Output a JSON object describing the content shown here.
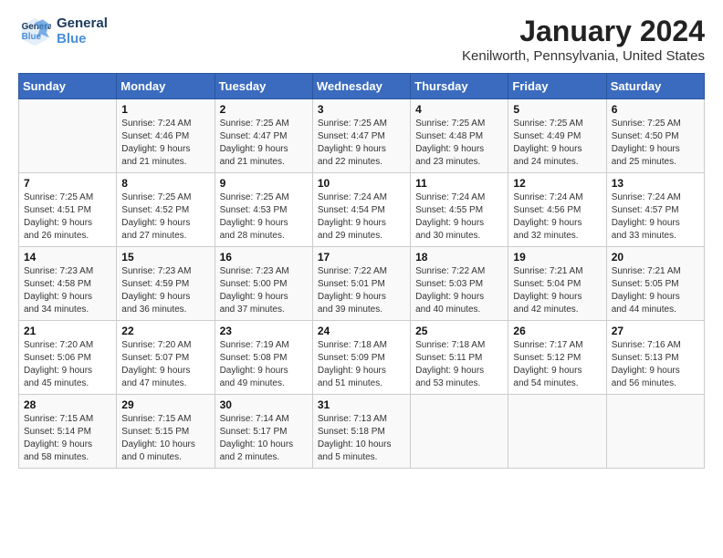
{
  "header": {
    "logo_line1": "General",
    "logo_line2": "Blue",
    "title": "January 2024",
    "subtitle": "Kenilworth, Pennsylvania, United States"
  },
  "days_of_week": [
    "Sunday",
    "Monday",
    "Tuesday",
    "Wednesday",
    "Thursday",
    "Friday",
    "Saturday"
  ],
  "weeks": [
    [
      {
        "day": "",
        "info": ""
      },
      {
        "day": "1",
        "info": "Sunrise: 7:24 AM\nSunset: 4:46 PM\nDaylight: 9 hours\nand 21 minutes."
      },
      {
        "day": "2",
        "info": "Sunrise: 7:25 AM\nSunset: 4:47 PM\nDaylight: 9 hours\nand 21 minutes."
      },
      {
        "day": "3",
        "info": "Sunrise: 7:25 AM\nSunset: 4:47 PM\nDaylight: 9 hours\nand 22 minutes."
      },
      {
        "day": "4",
        "info": "Sunrise: 7:25 AM\nSunset: 4:48 PM\nDaylight: 9 hours\nand 23 minutes."
      },
      {
        "day": "5",
        "info": "Sunrise: 7:25 AM\nSunset: 4:49 PM\nDaylight: 9 hours\nand 24 minutes."
      },
      {
        "day": "6",
        "info": "Sunrise: 7:25 AM\nSunset: 4:50 PM\nDaylight: 9 hours\nand 25 minutes."
      }
    ],
    [
      {
        "day": "7",
        "info": "Sunrise: 7:25 AM\nSunset: 4:51 PM\nDaylight: 9 hours\nand 26 minutes."
      },
      {
        "day": "8",
        "info": "Sunrise: 7:25 AM\nSunset: 4:52 PM\nDaylight: 9 hours\nand 27 minutes."
      },
      {
        "day": "9",
        "info": "Sunrise: 7:25 AM\nSunset: 4:53 PM\nDaylight: 9 hours\nand 28 minutes."
      },
      {
        "day": "10",
        "info": "Sunrise: 7:24 AM\nSunset: 4:54 PM\nDaylight: 9 hours\nand 29 minutes."
      },
      {
        "day": "11",
        "info": "Sunrise: 7:24 AM\nSunset: 4:55 PM\nDaylight: 9 hours\nand 30 minutes."
      },
      {
        "day": "12",
        "info": "Sunrise: 7:24 AM\nSunset: 4:56 PM\nDaylight: 9 hours\nand 32 minutes."
      },
      {
        "day": "13",
        "info": "Sunrise: 7:24 AM\nSunset: 4:57 PM\nDaylight: 9 hours\nand 33 minutes."
      }
    ],
    [
      {
        "day": "14",
        "info": "Sunrise: 7:23 AM\nSunset: 4:58 PM\nDaylight: 9 hours\nand 34 minutes."
      },
      {
        "day": "15",
        "info": "Sunrise: 7:23 AM\nSunset: 4:59 PM\nDaylight: 9 hours\nand 36 minutes."
      },
      {
        "day": "16",
        "info": "Sunrise: 7:23 AM\nSunset: 5:00 PM\nDaylight: 9 hours\nand 37 minutes."
      },
      {
        "day": "17",
        "info": "Sunrise: 7:22 AM\nSunset: 5:01 PM\nDaylight: 9 hours\nand 39 minutes."
      },
      {
        "day": "18",
        "info": "Sunrise: 7:22 AM\nSunset: 5:03 PM\nDaylight: 9 hours\nand 40 minutes."
      },
      {
        "day": "19",
        "info": "Sunrise: 7:21 AM\nSunset: 5:04 PM\nDaylight: 9 hours\nand 42 minutes."
      },
      {
        "day": "20",
        "info": "Sunrise: 7:21 AM\nSunset: 5:05 PM\nDaylight: 9 hours\nand 44 minutes."
      }
    ],
    [
      {
        "day": "21",
        "info": "Sunrise: 7:20 AM\nSunset: 5:06 PM\nDaylight: 9 hours\nand 45 minutes."
      },
      {
        "day": "22",
        "info": "Sunrise: 7:20 AM\nSunset: 5:07 PM\nDaylight: 9 hours\nand 47 minutes."
      },
      {
        "day": "23",
        "info": "Sunrise: 7:19 AM\nSunset: 5:08 PM\nDaylight: 9 hours\nand 49 minutes."
      },
      {
        "day": "24",
        "info": "Sunrise: 7:18 AM\nSunset: 5:09 PM\nDaylight: 9 hours\nand 51 minutes."
      },
      {
        "day": "25",
        "info": "Sunrise: 7:18 AM\nSunset: 5:11 PM\nDaylight: 9 hours\nand 53 minutes."
      },
      {
        "day": "26",
        "info": "Sunrise: 7:17 AM\nSunset: 5:12 PM\nDaylight: 9 hours\nand 54 minutes."
      },
      {
        "day": "27",
        "info": "Sunrise: 7:16 AM\nSunset: 5:13 PM\nDaylight: 9 hours\nand 56 minutes."
      }
    ],
    [
      {
        "day": "28",
        "info": "Sunrise: 7:15 AM\nSunset: 5:14 PM\nDaylight: 9 hours\nand 58 minutes."
      },
      {
        "day": "29",
        "info": "Sunrise: 7:15 AM\nSunset: 5:15 PM\nDaylight: 10 hours\nand 0 minutes."
      },
      {
        "day": "30",
        "info": "Sunrise: 7:14 AM\nSunset: 5:17 PM\nDaylight: 10 hours\nand 2 minutes."
      },
      {
        "day": "31",
        "info": "Sunrise: 7:13 AM\nSunset: 5:18 PM\nDaylight: 10 hours\nand 5 minutes."
      },
      {
        "day": "",
        "info": ""
      },
      {
        "day": "",
        "info": ""
      },
      {
        "day": "",
        "info": ""
      }
    ]
  ]
}
